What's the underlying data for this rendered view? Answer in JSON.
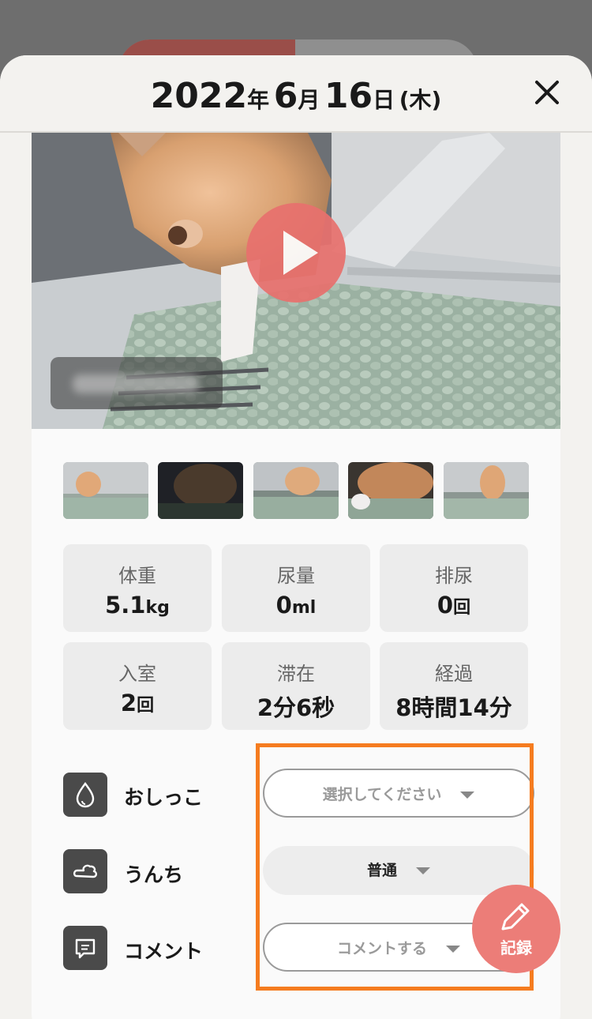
{
  "header": {
    "year": "2022",
    "year_unit": "年",
    "month": "6",
    "month_unit": "月",
    "day": "16",
    "day_unit": "日",
    "weekday": "(木)"
  },
  "icons": {
    "close": "close-icon",
    "play": "play-icon",
    "pee": "droplet-icon",
    "poop": "poop-icon",
    "comment": "comment-icon",
    "record": "pencil-icon"
  },
  "stats": [
    {
      "label": "体重",
      "value": "5.1",
      "unit": "kg"
    },
    {
      "label": "尿量",
      "value": "0",
      "unit": "ml"
    },
    {
      "label": "排尿",
      "value": "0",
      "unit": "回"
    },
    {
      "label": "入室",
      "value": "2",
      "unit": "回"
    },
    {
      "label": "滞在",
      "value": "2分6秒",
      "unit": ""
    },
    {
      "label": "経過",
      "value": "8時間14分",
      "unit": ""
    }
  ],
  "records": {
    "pee": {
      "label": "おしっこ",
      "value": "選択してください"
    },
    "poop": {
      "label": "うんち",
      "value": "普通"
    },
    "comment": {
      "label": "コメント",
      "value": "コメントする"
    }
  },
  "fab": {
    "label": "記録"
  },
  "colors": {
    "accent": "#ec7d78",
    "highlight": "#f57c1f",
    "play": "#e8716e"
  }
}
